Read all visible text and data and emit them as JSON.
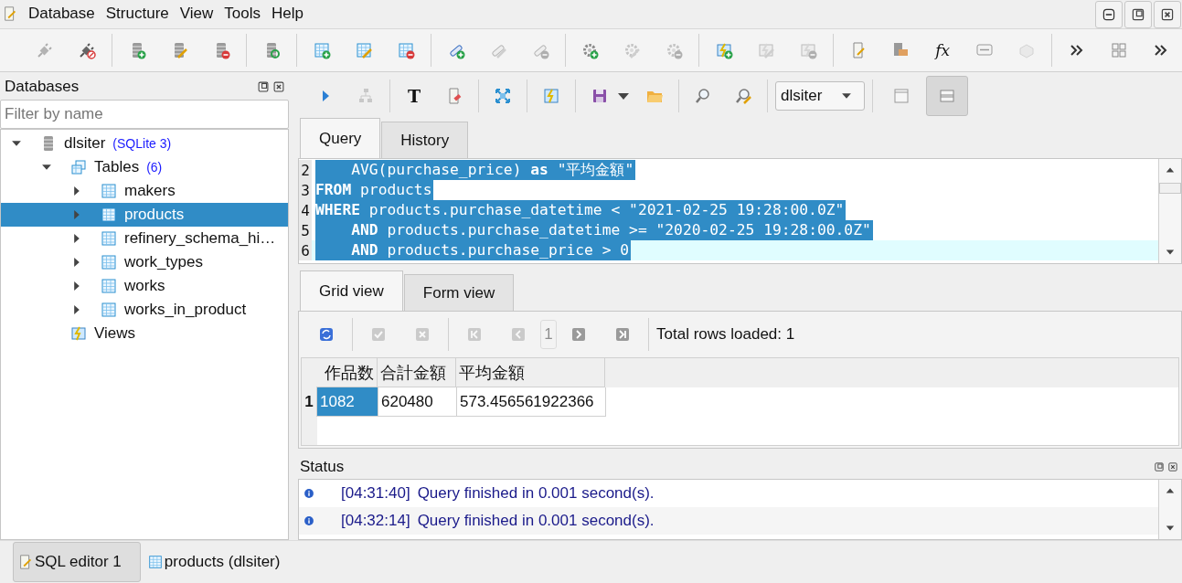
{
  "menu": [
    {
      "label": "Database"
    },
    {
      "label": "Structure"
    },
    {
      "label": "View"
    },
    {
      "label": "Tools"
    },
    {
      "label": "Help"
    }
  ],
  "main_toolbar": [
    [
      {
        "disabled": true
      },
      {
        "disabled": false
      }
    ],
    [
      {
        "disabled": false
      },
      {
        "disabled": false
      },
      {
        "disabled": false
      }
    ],
    [
      {
        "disabled": false
      }
    ],
    [
      {
        "disabled": false
      },
      {
        "disabled": false
      },
      {
        "disabled": false
      }
    ],
    [
      {
        "disabled": false
      },
      {
        "disabled": true
      },
      {
        "disabled": true
      }
    ],
    [
      {
        "disabled": false
      },
      {
        "disabled": true
      },
      {
        "disabled": true
      }
    ],
    [
      {
        "disabled": false
      },
      {
        "disabled": true
      },
      {
        "disabled": true
      }
    ],
    [
      {
        "disabled": false
      },
      {
        "disabled": false
      },
      {
        "glyph": "fx",
        "disabled": false
      },
      {
        "disabled": false
      },
      {
        "disabled": true
      }
    ]
  ],
  "databases_panel": {
    "title": "Databases",
    "filter": {
      "placeholder": "Filter by name"
    },
    "tree": [
      {
        "label": "dlsiter",
        "note": "(SQLite 3)",
        "kind": "database",
        "expanded": true,
        "selected": false,
        "children": [
          {
            "label": "Tables",
            "note": "(6)",
            "kind": "folder",
            "expanded": true,
            "selected": false,
            "children": [
              {
                "label": "makers",
                "kind": "table",
                "expanded": false,
                "selected": false
              },
              {
                "label": "products",
                "kind": "table",
                "expanded": false,
                "selected": true
              },
              {
                "label": "refinery_schema_hi…",
                "kind": "table",
                "expanded": false,
                "selected": false
              },
              {
                "label": "work_types",
                "kind": "table",
                "expanded": false,
                "selected": false
              },
              {
                "label": "works",
                "kind": "table",
                "expanded": false,
                "selected": false
              },
              {
                "label": "works_in_product",
                "kind": "table",
                "expanded": false,
                "selected": false
              }
            ]
          },
          {
            "label": "Views",
            "kind": "views",
            "selected": false
          }
        ]
      }
    ]
  },
  "editor_toolbar": {
    "groups": [
      [
        {
          "disabled": false
        },
        {
          "disabled": true
        }
      ],
      [
        {
          "glyph": "T",
          "disabled": false
        },
        {
          "disabled": false
        }
      ],
      [
        {
          "disabled": false
        }
      ],
      [
        {
          "disabled": false
        }
      ],
      [
        {
          "disabled": false
        },
        {
          "disabled": false
        },
        {
          "disabled": false
        }
      ],
      [
        {
          "disabled": false
        },
        {
          "disabled": false
        }
      ]
    ],
    "database": "dlsiter",
    "layouts": [
      {
        "selected": false
      },
      {
        "selected": true
      }
    ]
  },
  "query_tabs": [
    {
      "label": "Query",
      "selected": true
    },
    {
      "label": "History",
      "selected": false
    }
  ],
  "editor_lines": [
    {
      "number": "2",
      "text": "    AVG(purchase_price) **as** \"平均金額\"",
      "selected": true,
      "current": false
    },
    {
      "number": "3",
      "text": "**FROM** products",
      "selected": true,
      "current": false
    },
    {
      "number": "4",
      "text": "**WHERE** products.purchase_datetime < \"2021-02-25 19:28:00.0Z\"",
      "selected": true,
      "current": false
    },
    {
      "number": "5",
      "text": "    **AND** products.purchase_datetime >= \"2020-02-25 19:28:00.0Z\"",
      "selected": true,
      "current": false
    },
    {
      "number": "6",
      "text": "    **AND** products.purchase_price > 0",
      "selected": true,
      "current": true
    }
  ],
  "result_tabs": [
    {
      "label": "Grid view",
      "selected": true
    },
    {
      "label": "Form view",
      "selected": false
    }
  ],
  "results_toolbar": {
    "refresh": {
      "disabled": false
    },
    "edit": [
      {
        "disabled": true
      },
      {
        "disabled": true
      }
    ],
    "nav": [
      {
        "disabled": true
      },
      {
        "disabled": true
      },
      {
        "disabled": false
      },
      {
        "disabled": false
      }
    ],
    "page": {
      "value": "1",
      "disabled": true
    },
    "total": "Total rows loaded: 1"
  },
  "table": {
    "columns": [
      "作品数",
      "合計金額",
      "平均金額"
    ],
    "rows": [
      {
        "number": "1",
        "cells": [
          {
            "text": "1082",
            "selected": true
          },
          {
            "text": "620480",
            "selected": false
          },
          {
            "text": "573.456561922366",
            "selected": false
          }
        ]
      }
    ]
  },
  "status": {
    "title": "Status",
    "entries": [
      {
        "time": "[04:31:40]",
        "message": "Query finished in 0.001 second(s)."
      },
      {
        "time": "[04:32:14]",
        "message": "Query finished in 0.001 second(s)."
      }
    ]
  },
  "taskbar": [
    {
      "label": "SQL editor 1",
      "kind": "editor",
      "selected": true
    },
    {
      "label": "products (dlsiter)",
      "kind": "table",
      "selected": false
    }
  ]
}
